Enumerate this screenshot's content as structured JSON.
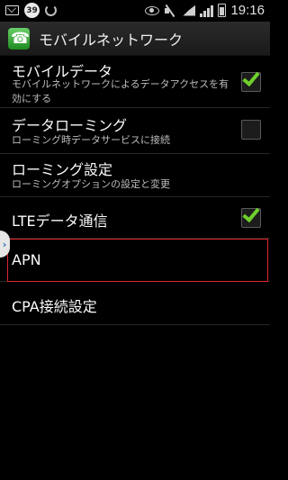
{
  "status_bar": {
    "badge_count": "39",
    "time": "19:16",
    "icons": [
      "mail-icon",
      "badge-icon",
      "sync-icon",
      "eye-icon",
      "mute-icon",
      "wifi-icon",
      "signal-icon",
      "battery-icon"
    ]
  },
  "action_bar": {
    "title": "モバイルネットワーク",
    "icon": "phone-icon"
  },
  "settings": {
    "mobile_data": {
      "title": "モバイルデータ",
      "summary": "モバイルネットワークによるデータアクセスを有効にする",
      "checked": true
    },
    "data_roaming": {
      "title": "データローミング",
      "summary": "ローミング時データサービスに接続",
      "checked": false
    },
    "roaming_settings": {
      "title": "ローミング設定",
      "summary": "ローミングオプションの設定と変更"
    },
    "lte": {
      "title": "LTEデータ通信",
      "checked": true
    },
    "apn": {
      "title": "APN"
    },
    "cpa": {
      "title": "CPA接続設定"
    }
  },
  "colors": {
    "check_green": "#6fd02b",
    "highlight_red": "#e0262a",
    "background": "#000000"
  }
}
